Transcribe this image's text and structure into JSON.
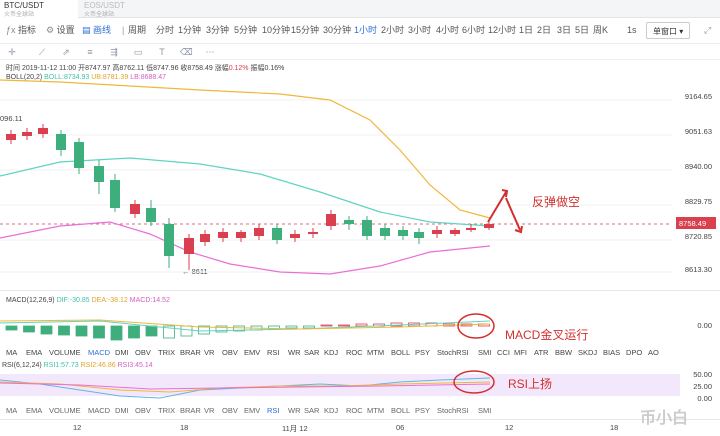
{
  "tabs": [
    {
      "title": "BTC/USDT",
      "subtitle": "火币全球站",
      "active": true
    },
    {
      "title": "EOS/USDT",
      "subtitle": "火币全球站",
      "active": false
    }
  ],
  "toolbar": {
    "indicator_label": "指标",
    "settings_label": "设置",
    "drawing_label": "画线",
    "period_label": "周期",
    "periods": [
      "分时",
      "1分钟",
      "3分钟",
      "5分钟",
      "10分钟",
      "15分钟",
      "30分钟",
      "1小时",
      "2小时",
      "3小时",
      "4小时",
      "6小时",
      "12小时",
      "1日",
      "2日",
      "3日",
      "5日",
      "周K"
    ],
    "active_period": "1小时",
    "interval": "1s",
    "chart_mode": "单窗口"
  },
  "info": {
    "time_label": "时间",
    "time": "2019-11-12 11:00",
    "open_label": "开",
    "open": "8747.97",
    "high_label": "高",
    "high": "8762.11",
    "low_label": "低",
    "low": "8747.96",
    "close_label": "收",
    "close": "8758.49",
    "change_label": "涨幅",
    "change": "0.12%",
    "amp_label": "振幅",
    "amp": "0.16%"
  },
  "boll": {
    "name": "BOLL(20,2)",
    "boll": "BOLL:8734.93",
    "ub": "UB:8781.39",
    "lb": "LB:8688.47"
  },
  "macd_info": {
    "name": "MACD(12,26,9)",
    "dif": "DIF:-30.85",
    "dea": "DEA:-38.12",
    "macd": "MACD:14.52"
  },
  "rsi_info": {
    "name": "RSI(6,12,24)",
    "rsi1": "RSI1:57.73",
    "rsi2": "RSI2:46.86",
    "rsi3": "RSI3:45.14"
  },
  "price_axis": [
    "9164.65",
    "9051.63",
    "8940.00",
    "8829.75",
    "8720.85",
    "8613.30"
  ],
  "current_price": "8758.49",
  "high_marker": "096.11",
  "low_marker": "8611",
  "macd_axis": [
    "0.00"
  ],
  "rsi_axis": [
    "50.00",
    "25.00",
    "0.00"
  ],
  "indicator_tabs": [
    "MA",
    "EMA",
    "VOLUME",
    "MACD",
    "DMI",
    "OBV",
    "TRIX",
    "BRAR",
    "VR",
    "OBV",
    "EMV",
    "RSI",
    "WR",
    "SAR",
    "KDJ",
    "ROC",
    "MTM",
    "BOLL",
    "PSY",
    "StochRSI",
    "SMI",
    "CCI",
    "MFI",
    "ATR",
    "BBW",
    "SKDJ",
    "BIAS",
    "DPO",
    "AO"
  ],
  "indicator_tabs_row2": [
    "MA",
    "EMA",
    "VOLUME",
    "MACD",
    "DMI",
    "OBV",
    "TRIX",
    "BRAR",
    "VR",
    "OBV",
    "EMV",
    "RSI",
    "WR",
    "SAR",
    "KDJ",
    "ROC",
    "MTM",
    "BOLL",
    "PSY",
    "StochRSI",
    "SMI"
  ],
  "active_indicator": "MACD",
  "date_axis": [
    "12",
    "18",
    "11月 12",
    "06",
    "12",
    "18"
  ],
  "annotations": {
    "short": "反弹做空",
    "macd": "MACD金叉运行",
    "rsi": "RSI上扬"
  },
  "watermark": "币小白",
  "colors": {
    "up": "#d93f4f",
    "down": "#3fae7d",
    "accent": "#2f6fd6",
    "boll_mid": "#5fd4c1",
    "boll_up": "#f0b73a",
    "boll_low": "#e96fd8",
    "annotation": "#d32f2f"
  }
}
